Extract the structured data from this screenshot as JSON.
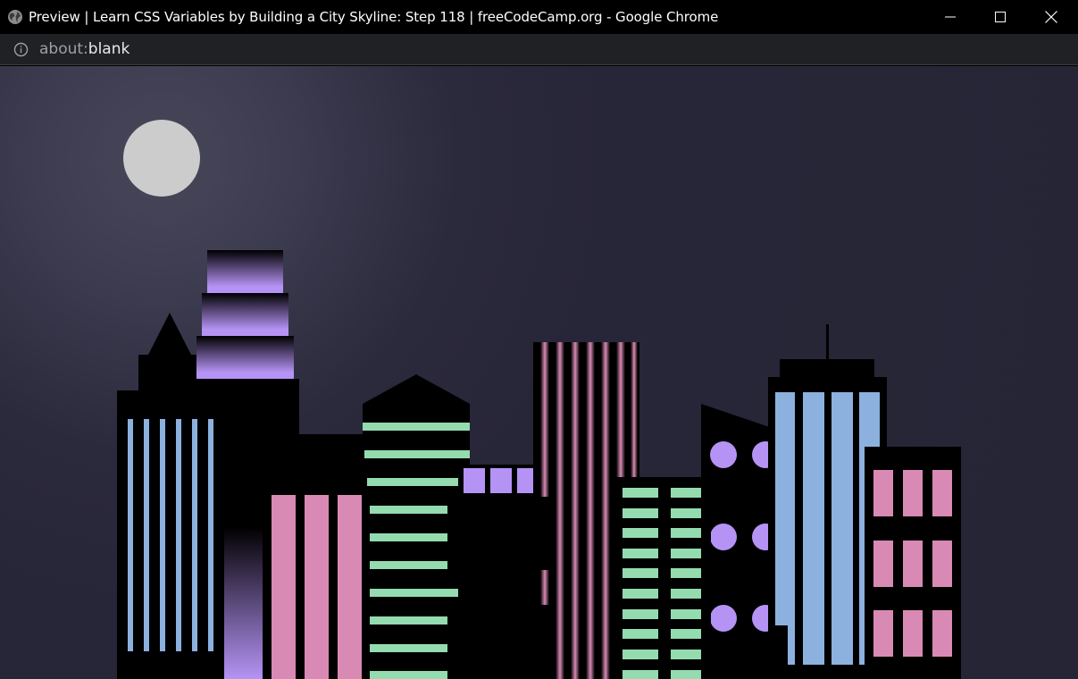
{
  "window": {
    "title": "Preview | Learn CSS Variables by Building a City Skyline: Step 118 | freeCodeCamp.org - Google Chrome",
    "tab_icon": "globe-icon",
    "controls": [
      "minimize-icon",
      "maximize-icon",
      "close-icon"
    ]
  },
  "address_bar": {
    "icon": "info-icon",
    "scheme": "about:",
    "host": "blank"
  },
  "colors": {
    "sky": "#262536",
    "moon": "#cccccc",
    "building": "#000000",
    "purple": "#b593f5",
    "pink": "#d98ab4",
    "blue": "#8cb1de",
    "green": "#94dbb0"
  }
}
